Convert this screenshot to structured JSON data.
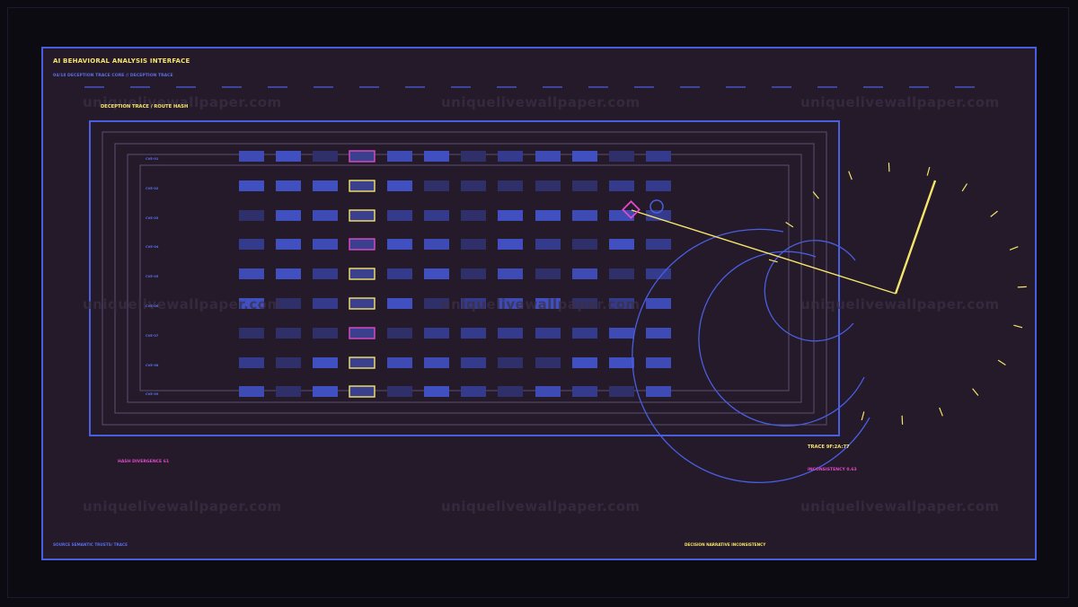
{
  "app": {
    "title": "AI BEHAVIORAL ANALYSIS INTERFACE",
    "subtitle": "04/18  DECEPTION TRACE CORE  // DECEPTION TRACE"
  },
  "grid": {
    "section_label": "DECEPTION TRACE / ROUTE HASH",
    "row_labels": [
      "CVE-01",
      "CVE-02",
      "CVE-03",
      "CVE-04",
      "CVE-05",
      "CVE-06",
      "CVE-07",
      "CVE-08",
      "CVE-09"
    ]
  },
  "annotations": {
    "hash_divergence": "HASH DIVERGENCE 61",
    "trace": "TRACE 9F:2A:77",
    "inconsistency": "INCONSISTENCY 0.63"
  },
  "footer": {
    "left": "SOURCE  SEMANTIC TRUSTS/ TRACE",
    "right": "DECISION  NARRATIVE INCONSISTENCY"
  },
  "watermark": {
    "text": "uniquelivewallpaper.com"
  },
  "colors": {
    "accent_blue": "#4a5ee0",
    "accent_yellow": "#f5e56a",
    "accent_magenta": "#e04ac8",
    "panel_bg": "#241a2a",
    "outer_bg": "#0d0b12"
  }
}
